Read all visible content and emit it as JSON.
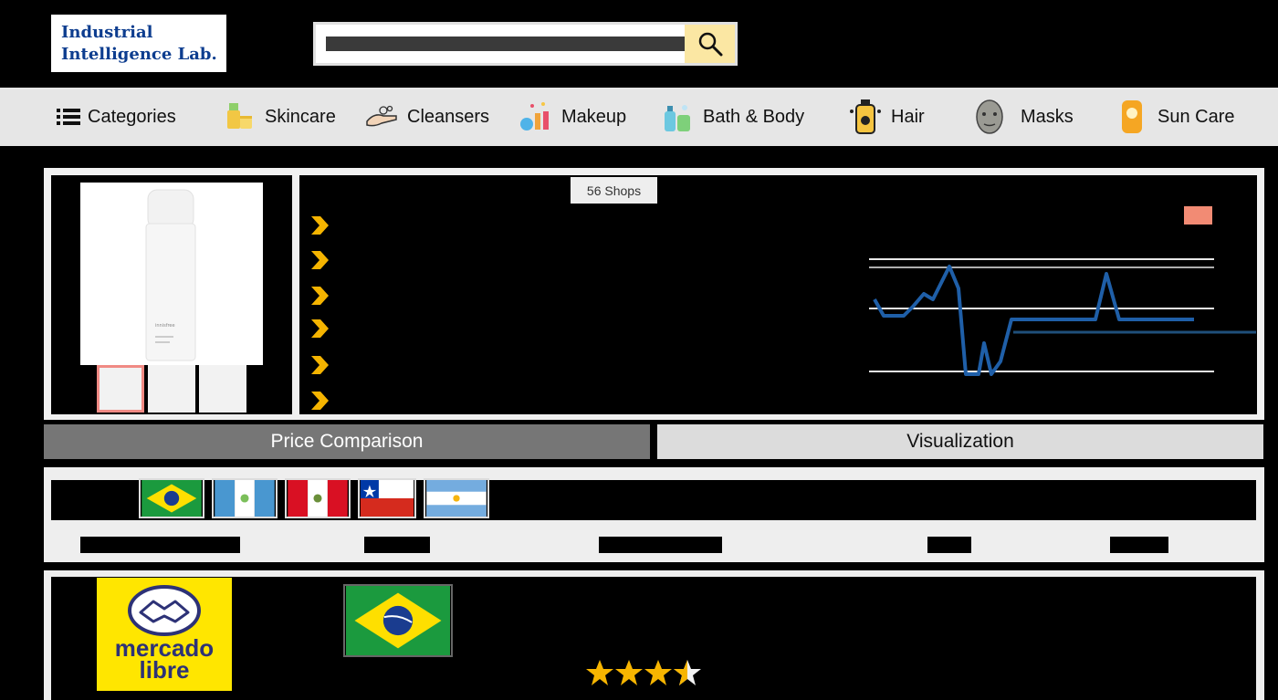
{
  "header": {
    "logo_line1": "Industrial",
    "logo_line2": "Intelligence Lab.",
    "search": {
      "placeholder": ""
    }
  },
  "categories": [
    {
      "label": "Categories",
      "icon": "menu-icon"
    },
    {
      "label": "Skincare",
      "icon": "skincare-icon"
    },
    {
      "label": "Cleansers",
      "icon": "cleanser-icon"
    },
    {
      "label": "Makeup",
      "icon": "makeup-icon"
    },
    {
      "label": "Bath & Body",
      "icon": "bath-body-icon"
    },
    {
      "label": "Hair",
      "icon": "hair-icon"
    },
    {
      "label": "Masks",
      "icon": "mask-icon"
    },
    {
      "label": "Sun Care",
      "icon": "sun-care-icon"
    }
  ],
  "product": {
    "shops_badge": "56 Shops",
    "bottle_brand": "innisfree",
    "thumbnails_count": 3
  },
  "tabs": {
    "price": "Price Comparison",
    "visualization": "Visualization"
  },
  "filters": {
    "countries": [
      "Brazil",
      "Guatemala",
      "Peru",
      "Chile",
      "Argentina"
    ]
  },
  "result": {
    "shop": "mercado libre",
    "shop_line1": "mercado",
    "shop_line2": "libre",
    "country": "Brazil",
    "rating": 3.5
  },
  "colors": {
    "accent_arrow": "#f5b400",
    "chart_line": "#1f5fa8",
    "star": "#f7b500",
    "tab_active": "#767676"
  }
}
